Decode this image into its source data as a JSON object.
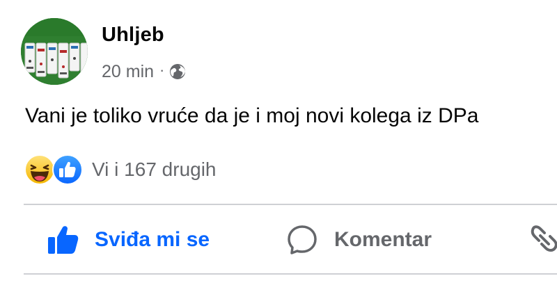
{
  "post": {
    "author": "Uhljeb",
    "time": "20 min",
    "separator": "·",
    "privacy_icon": "globe-icon",
    "text": "Vani je toliko vruće da je i moj novi kolega iz DPa"
  },
  "reactions": {
    "icons": [
      "haha-icon",
      "like-icon"
    ],
    "summary": "Vi i 167 drugih"
  },
  "actions": {
    "like_label": "Sviđa mi se",
    "comment_label": "Komentar"
  },
  "colors": {
    "accent": "#0866ff",
    "secondary_text": "#65676b",
    "primary_text": "#050505",
    "divider": "#ced0d4"
  }
}
